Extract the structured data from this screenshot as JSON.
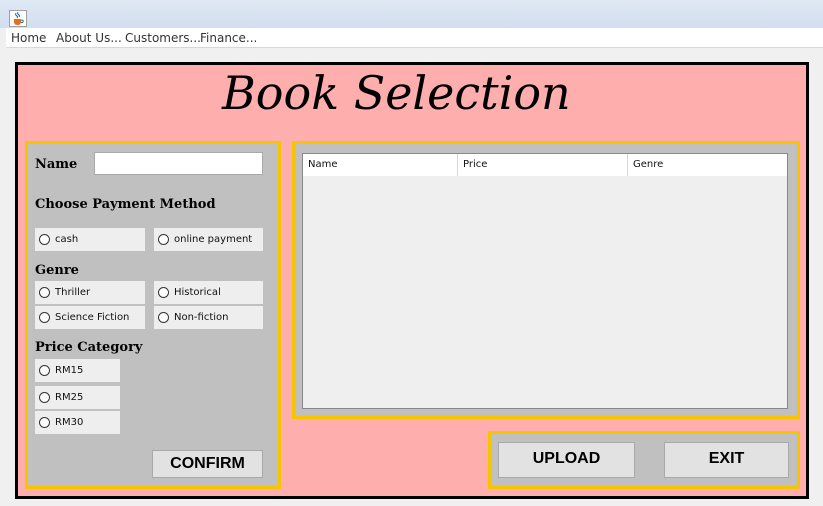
{
  "menu": {
    "items": [
      "Home",
      "About Us...",
      "Customers...",
      "Finance..."
    ]
  },
  "page": {
    "title": "Book Selection"
  },
  "form": {
    "name_label": "Name",
    "name_value": "",
    "payment_label": "Choose Payment Method",
    "payment_options": [
      "cash",
      "online payment"
    ],
    "genre_label": "Genre",
    "genre_options": [
      "Thriller",
      "Historical",
      "Science Fiction",
      "Non-fiction"
    ],
    "price_label": "Price Category",
    "price_options": [
      "RM15",
      "RM25",
      "RM30"
    ],
    "confirm_label": "CONFIRM"
  },
  "table": {
    "columns": [
      "Name",
      "Price",
      "Genre"
    ],
    "rows": []
  },
  "actions": {
    "upload_label": "UPLOAD",
    "exit_label": "EXIT"
  },
  "colors": {
    "frame_background": "#ffaeae",
    "panel_background": "#c0c0c0",
    "panel_border": "#f7c400"
  },
  "icons": {
    "app": "java-cup-icon",
    "radio": "radio-unchecked-icon"
  }
}
